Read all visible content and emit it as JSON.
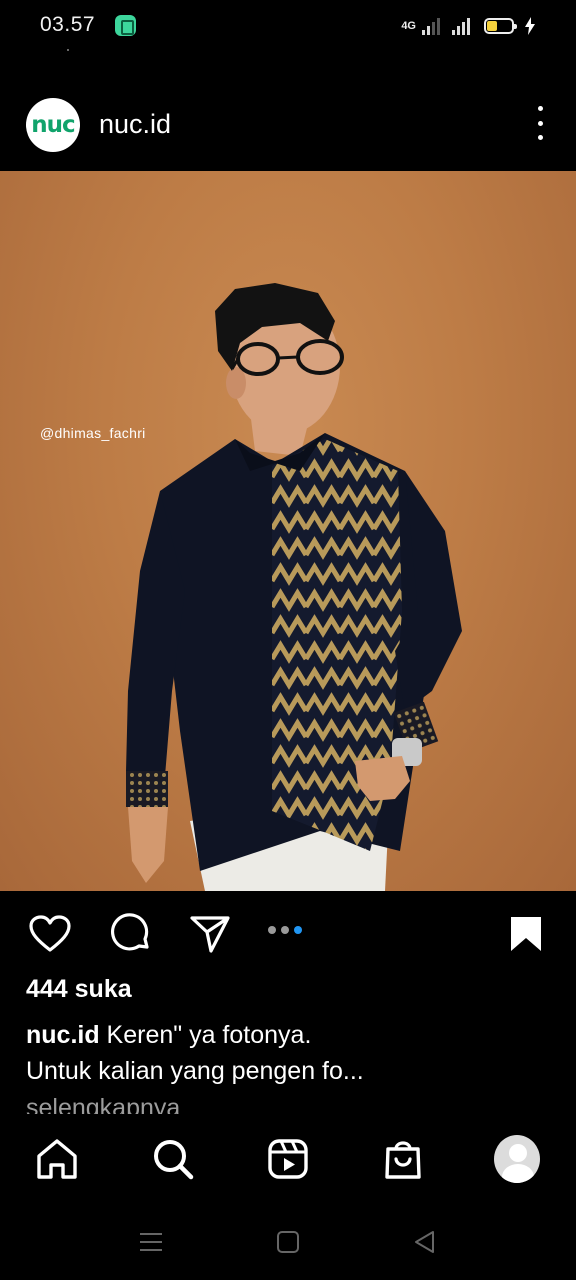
{
  "status_bar": {
    "time": "03.57",
    "network_label": "4G",
    "icons": [
      "app-notification-icon",
      "signal-4g-icon",
      "signal-icon",
      "battery-icon",
      "charging-icon"
    ],
    "battery_color": "#f6d23d"
  },
  "post": {
    "account_avatar_text": "nuc",
    "username": "nuc.id",
    "photo_tag": "@dhimas_fachri",
    "carousel_count": 3,
    "carousel_active_index": 2,
    "likes": "444 suka",
    "caption_user": "nuc.id",
    "caption_text": " Keren\" ya fotonya.",
    "caption_line2": "Untuk kalian yang pengen fo...",
    "caption_more": "selengkapnya",
    "icons": [
      "heart-icon",
      "comment-icon",
      "share-icon",
      "save-bookmark-icon",
      "more-options-icon"
    ]
  },
  "bottom_nav": {
    "items": [
      "home-icon",
      "search-icon",
      "reels-icon",
      "shop-icon",
      "profile-avatar"
    ]
  },
  "system_nav": {
    "items": [
      "menu-icon",
      "home-square-icon",
      "back-icon"
    ]
  },
  "colors": {
    "background": "#000000",
    "brand_green": "#10a36b",
    "active_dot": "#2196f3",
    "photo_backdrop": "#bd7c46"
  }
}
